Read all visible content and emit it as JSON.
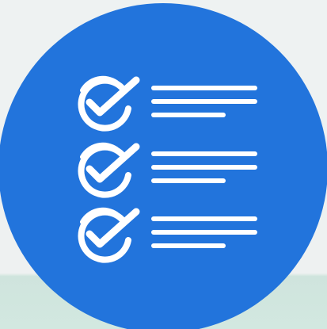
{
  "icon": {
    "name": "checklist-icon",
    "circle_color": "#2274dc",
    "stroke_color": "#ffffff",
    "background_color": "#eef1f1",
    "ground_color": "#d2e8e0",
    "rows": [
      {
        "item": "check-item-1",
        "lines": 3
      },
      {
        "item": "check-item-2",
        "lines": 3
      },
      {
        "item": "check-item-3",
        "lines": 3
      }
    ]
  }
}
